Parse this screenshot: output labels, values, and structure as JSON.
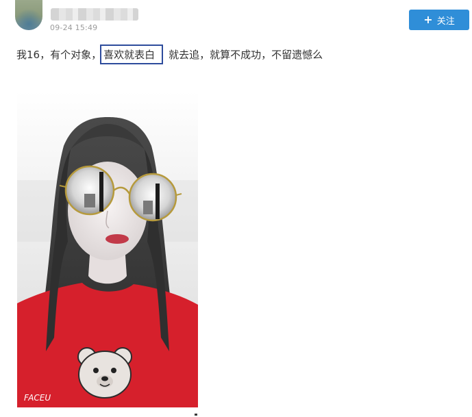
{
  "post": {
    "timestamp": "09-24 15:49",
    "follow_button": {
      "icon": "plus-icon",
      "label": "关注",
      "color": "#2f8ed8"
    },
    "text_before": "我16，有个对象，",
    "text_highlight": "喜欢就表白",
    "text_after": "就去追，就算不成功，不留遗憾么",
    "highlight_color": "#2d4b9c",
    "photo_watermark": "FACEU"
  }
}
